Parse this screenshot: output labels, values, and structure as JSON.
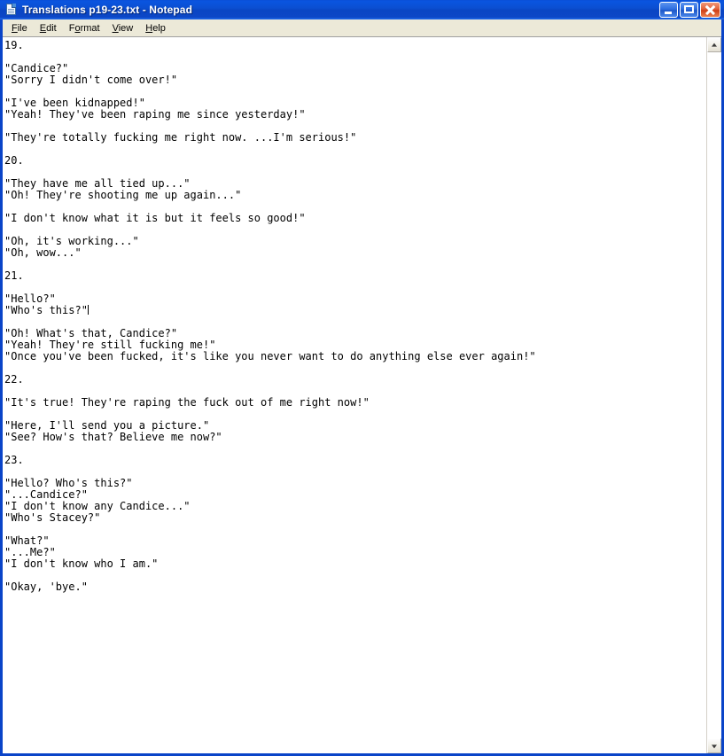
{
  "window": {
    "title": "Translations p19-23.txt - Notepad",
    "icon": "notepad-document-icon",
    "accent_color": "#0a44c8",
    "menubar_color": "#ece9d8",
    "close_button_color": "#cf3f16"
  },
  "caption_buttons": {
    "minimize_label": "Minimize",
    "maximize_label": "Maximize",
    "close_label": "Close"
  },
  "menu": {
    "items": [
      {
        "label": "File",
        "accel": "F"
      },
      {
        "label": "Edit",
        "accel": "E"
      },
      {
        "label": "Format",
        "accel": "o"
      },
      {
        "label": "View",
        "accel": "V"
      },
      {
        "label": "Help",
        "accel": "H"
      }
    ]
  },
  "editor": {
    "lines": [
      "19.",
      "",
      "\"Candice?\"",
      "\"Sorry I didn't come over!\"",
      "",
      "\"I've been kidnapped!\"",
      "\"Yeah! They've been raping me since yesterday!\"",
      "",
      "\"They're totally fucking me right now. ...I'm serious!\"",
      "",
      "20.",
      "",
      "\"They have me all tied up...\"",
      "\"Oh! They're shooting me up again...\"",
      "",
      "\"I don't know what it is but it feels so good!\"",
      "",
      "\"Oh, it's working...\"",
      "\"Oh, wow...\"",
      "",
      "21.",
      "",
      "\"Hello?\"",
      "\"Who's this?\"",
      "",
      "\"Oh! What's that, Candice?\"",
      "\"Yeah! They're still fucking me!\"",
      "\"Once you've been fucked, it's like you never want to do anything else ever again!\"",
      "",
      "22.",
      "",
      "\"It's true! They're raping the fuck out of me right now!\"",
      "",
      "\"Here, I'll send you a picture.\"",
      "\"See? How's that? Believe me now?\"",
      "",
      "23.",
      "",
      "\"Hello? Who's this?\"",
      "\"...Candice?\"",
      "\"I don't know any Candice...\"",
      "\"Who's Stacey?\"",
      "",
      "\"What?\"",
      "\"...Me?\"",
      "\"I don't know who I am.\"",
      "",
      "\"Okay, 'bye.\""
    ],
    "caret_line_index": 23,
    "text_color": "#000000",
    "background_color": "#ffffff"
  },
  "scrollbar": {
    "up_arrow_label": "Scroll up",
    "down_arrow_label": "Scroll down",
    "track_label": "Vertical scroll track"
  }
}
